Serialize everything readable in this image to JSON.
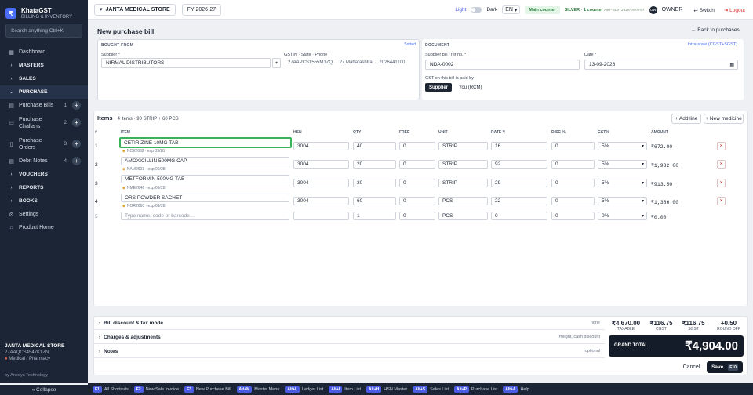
{
  "app": {
    "name": "KhataGST",
    "subtitle": "BILLING & INVENTORY",
    "logo": "₹"
  },
  "sidebar": {
    "search_placeholder": "Search anything  Ctrl+K",
    "items": [
      {
        "label": "Dashboard",
        "icon": "grid-icon"
      },
      {
        "label": "MASTERS",
        "icon": "chevron-right-icon"
      },
      {
        "label": "SALES",
        "icon": "chevron-right-icon"
      },
      {
        "label": "PURCHASE",
        "icon": "chevron-down-icon"
      },
      {
        "label": "Purchase Bills",
        "count": "1"
      },
      {
        "label": "Purchase Challans",
        "count": "2"
      },
      {
        "label": "Purchase Orders",
        "count": "3"
      },
      {
        "label": "Debit Notes",
        "count": "4"
      },
      {
        "label": "VOUCHERS",
        "icon": "chevron-right-icon"
      },
      {
        "label": "REPORTS",
        "icon": "chevron-right-icon"
      },
      {
        "label": "BOOKS",
        "icon": "chevron-right-icon"
      },
      {
        "label": "Settings",
        "icon": "gear-icon"
      },
      {
        "label": "Product Home",
        "icon": "home-icon"
      }
    ],
    "shop_name": "JANTA MEDICAL STORE",
    "shop_gstin": "27AAQCS4547K1ZN",
    "shop_type": "Medical / Pharmacy",
    "powered_by": "by Anedya Technology",
    "collapse_label": "« Collapse"
  },
  "topbar": {
    "company": "JANTA MEDICAL STORE",
    "fy": "FY 2026-27",
    "theme_light": "Light",
    "theme_dark": "Dark",
    "lang": "EN",
    "counter": "Main counter",
    "plan": "SILVER · 1 counter",
    "plan_code": "ANO-SLV-2026-A07F97",
    "avatar": "OW",
    "role": "OWNER",
    "switch": "Switch",
    "logout": "Logout"
  },
  "page": {
    "title": "New purchase bill",
    "back": "← Back to purchases"
  },
  "bought_from": {
    "section": "BOUGHT FROM",
    "tag": "Sorted",
    "supplier_label": "Supplier *",
    "supplier": "NIRMAL DISTRIBUTORS",
    "add": "+",
    "gstin_label": "GSTIN · State · Phone",
    "gstin": "27AAPCS1555M1ZQ",
    "state": "27 Maharashtra",
    "phone": "2026441100"
  },
  "document": {
    "section": "DOCUMENT",
    "intra": "Intra-state (CGST+SGST)",
    "ref_label": "Supplier bill / ref no. *",
    "ref": "NDA-0002",
    "date_label": "Date *",
    "date": "13-09-2026",
    "gst_label": "GST on this bill is paid by",
    "opt_supplier": "Supplier",
    "opt_rcm": "You (RCM)"
  },
  "items": {
    "title": "Items",
    "summary": "4 items · 90 STRIP + 60 PCS",
    "add_line": "+ Add line",
    "new_medicine": "+ New medicine",
    "headers": {
      "num": "#",
      "item": "ITEM",
      "hsn": "HSN",
      "qty": "QTY",
      "free": "FREE",
      "unit": "UNIT",
      "rate": "RATE ₹",
      "disc": "DISC %",
      "gst": "GST%",
      "amount": "AMOUNT"
    },
    "rows": [
      {
        "n": "1",
        "item": "CETIRIZINE 10MG TAB",
        "batch": "NCE2632 · exp 09/28",
        "hsn": "3004",
        "qty": "40",
        "free": "0",
        "unit": "STRIP",
        "rate": "16",
        "disc": "0",
        "gst": "5%",
        "amount": "₹672.00"
      },
      {
        "n": "2",
        "item": "AMOXICILLIN 500MG CAP",
        "batch": "NAM2623 · exp 09/28",
        "hsn": "3004",
        "qty": "20",
        "free": "0",
        "unit": "STRIP",
        "rate": "92",
        "disc": "0",
        "gst": "5%",
        "amount": "₹1,932.00"
      },
      {
        "n": "3",
        "item": "METFORMIN 500MG TAB",
        "batch": "NME2646 · exp 09/28",
        "hsn": "3004",
        "qty": "30",
        "free": "0",
        "unit": "STRIP",
        "rate": "29",
        "disc": "0",
        "gst": "5%",
        "amount": "₹913.50"
      },
      {
        "n": "4",
        "item": "ORS POWDER SACHET",
        "batch": "NOR2660 · exp 09/28",
        "hsn": "3004",
        "qty": "60",
        "free": "0",
        "unit": "PCS",
        "rate": "22",
        "disc": "0",
        "gst": "5%",
        "amount": "₹1,386.00"
      },
      {
        "n": "5",
        "item_placeholder": "Type name, code or barcode…",
        "hsn": "",
        "qty": "1",
        "free": "0",
        "unit": "PCS",
        "rate": "0",
        "disc": "0",
        "gst": "0%",
        "amount": "₹0.00"
      }
    ],
    "delete": "×"
  },
  "footer_sections": [
    {
      "label": "Bill discount & tax mode",
      "hint": "none"
    },
    {
      "label": "Charges & adjustments",
      "hint": "freight, cash discount"
    },
    {
      "label": "Notes",
      "hint": "optional"
    }
  ],
  "totals": {
    "taxable": "₹4,670.00",
    "taxable_label": "TAXABLE",
    "cgst": "₹116.75",
    "cgst_label": "CGST",
    "sgst": "₹116.75",
    "sgst_label": "SGST",
    "round": "+0.50",
    "round_label": "ROUND OFF",
    "grand_label": "GRAND TOTAL",
    "grand": "₹4,904.00"
  },
  "actions": {
    "cancel": "Cancel",
    "save": "Save",
    "save_key": "F10"
  },
  "shortcuts": [
    {
      "k": "F1",
      "t": "All Shortcuts"
    },
    {
      "k": "F2",
      "t": "New Sale Invoice"
    },
    {
      "k": "F3",
      "t": "New Purchase Bill"
    },
    {
      "k": "Alt+M",
      "t": "Master Menu"
    },
    {
      "k": "Alt+L",
      "t": "Ledger List"
    },
    {
      "k": "Alt+I",
      "t": "Item List"
    },
    {
      "k": "Alt+H",
      "t": "HSN Master"
    },
    {
      "k": "Alt+S",
      "t": "Sales List"
    },
    {
      "k": "Alt+P",
      "t": "Purchase List"
    },
    {
      "k": "Alt+A",
      "t": "Help"
    }
  ],
  "colors": {
    "accent": "#4a5ce0",
    "sidebar": "#1b2536",
    "focus": "#39b35a",
    "danger": "#dd3333"
  }
}
